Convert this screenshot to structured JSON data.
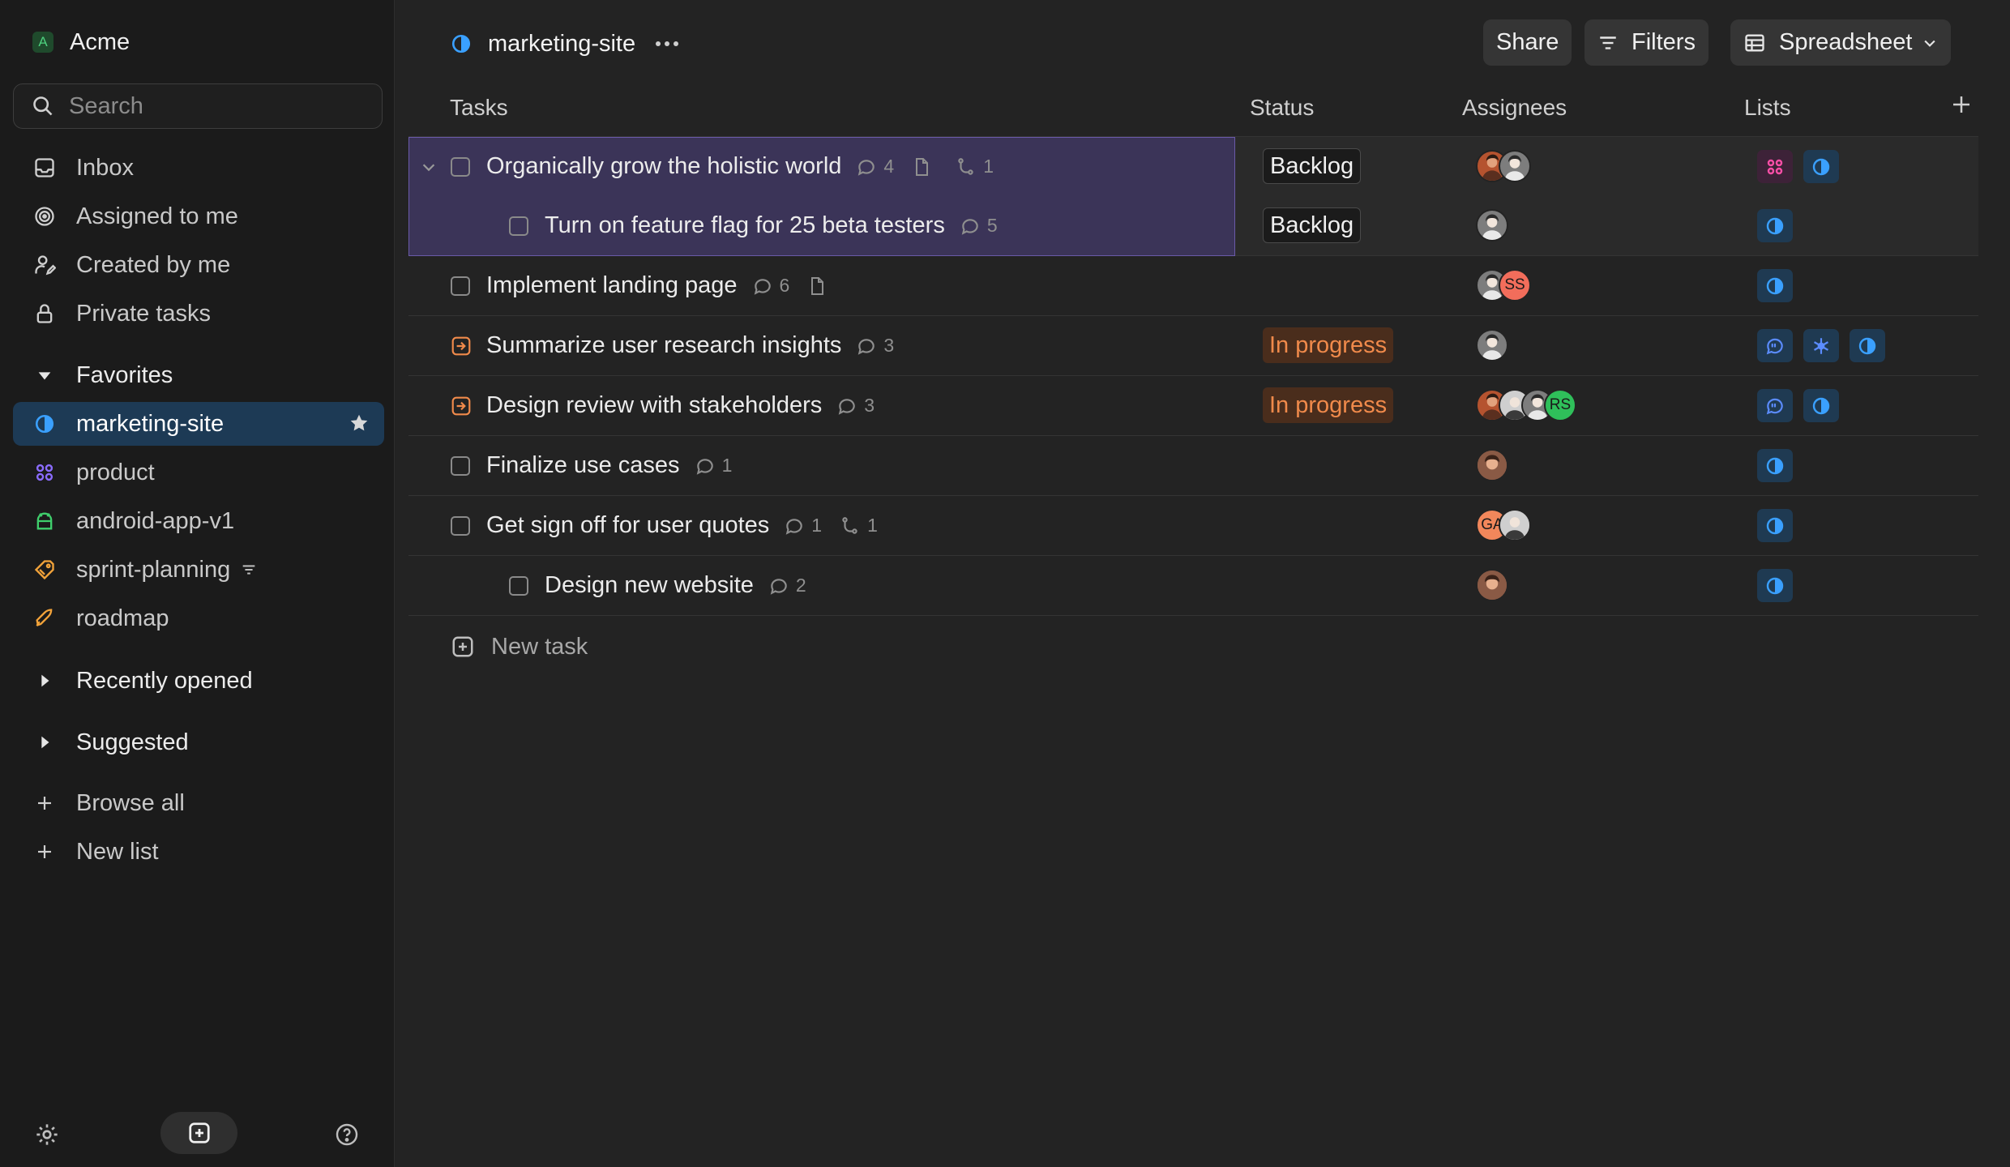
{
  "workspace": {
    "initial": "A",
    "name": "Acme"
  },
  "search": {
    "placeholder": "Search"
  },
  "nav": [
    {
      "label": "Inbox",
      "icon": "inbox-icon"
    },
    {
      "label": "Assigned to me",
      "icon": "target-icon"
    },
    {
      "label": "Created by me",
      "icon": "user-pen-icon"
    },
    {
      "label": "Private tasks",
      "icon": "lock-icon"
    }
  ],
  "favorites": {
    "heading": "Favorites",
    "items": [
      {
        "label": "marketing-site",
        "icon": "half-circle-icon",
        "color": "#3aa0ff",
        "active": true
      },
      {
        "label": "product",
        "icon": "grid-icon",
        "color": "#8b6cff"
      },
      {
        "label": "android-app-v1",
        "icon": "android-icon",
        "color": "#3fcf6c"
      },
      {
        "label": "sprint-planning",
        "icon": "tag-icon",
        "color": "#f2a33a"
      },
      {
        "label": "roadmap",
        "icon": "rocket-icon",
        "color": "#f2a33a"
      }
    ]
  },
  "recently_opened": {
    "heading": "Recently opened"
  },
  "suggested": {
    "heading": "Suggested"
  },
  "actions": {
    "browse_all": "Browse all",
    "new_list": "New list"
  },
  "header": {
    "project": "marketing-site",
    "share": "Share",
    "filters": "Filters",
    "view": "Spreadsheet"
  },
  "columns": {
    "tasks": "Tasks",
    "status": "Status",
    "assignees": "Assignees",
    "lists": "Lists"
  },
  "tasks": [
    {
      "title": "Organically grow the holistic world",
      "comments": "4",
      "has_doc": true,
      "subtasks": "1",
      "status": "Backlog",
      "assignees": [
        {
          "type": "photo",
          "color": "#b5532f"
        },
        {
          "type": "photo",
          "color": "#7d7d7d"
        }
      ],
      "lists": [
        "grid-pink",
        "half-blue"
      ]
    },
    {
      "title": "Turn on feature flag for 25 beta testers",
      "comments": "5",
      "status": "Backlog",
      "assignees": [
        {
          "type": "photo",
          "color": "#7d7d7d"
        }
      ],
      "lists": [
        "half-blue"
      ]
    },
    {
      "title": "Implement landing page",
      "comments": "6",
      "has_doc": true,
      "status": "",
      "assignees": [
        {
          "type": "photo",
          "color": "#7d7d7d"
        },
        {
          "type": "initials",
          "text": "SS",
          "color": "#f26d5b"
        }
      ],
      "lists": [
        "half-blue"
      ]
    },
    {
      "title": "Summarize user research insights",
      "comments": "3",
      "status": "In progress",
      "assignees": [
        {
          "type": "photo",
          "color": "#7d7d7d"
        }
      ],
      "lists": [
        "chat-blue",
        "snow-blue",
        "half-blue"
      ]
    },
    {
      "title": "Design review with stakeholders",
      "comments": "3",
      "status": "In progress",
      "assignees": [
        {
          "type": "photo",
          "color": "#b5532f"
        },
        {
          "type": "photo",
          "color": "#9a9a9a"
        },
        {
          "type": "photo",
          "color": "#7d7d7d"
        },
        {
          "type": "initials",
          "text": "RS",
          "color": "#2fbf5a"
        }
      ],
      "lists": [
        "chat-blue",
        "half-blue"
      ]
    },
    {
      "title": "Finalize use cases",
      "comments": "1",
      "status": "",
      "assignees": [
        {
          "type": "photo",
          "color": "#a0624a"
        }
      ],
      "lists": [
        "half-blue"
      ]
    },
    {
      "title": "Get sign off for user quotes",
      "comments": "1",
      "subtasks": "1",
      "status": "",
      "assignees": [
        {
          "type": "initials",
          "text": "GA",
          "color": "#f2875b"
        },
        {
          "type": "photo",
          "color": "#9a9a9a"
        }
      ],
      "lists": [
        "half-blue"
      ]
    },
    {
      "title": "Design new website",
      "comments": "2",
      "status": "",
      "assignees": [
        {
          "type": "photo",
          "color": "#a0624a"
        }
      ],
      "lists": [
        "half-blue"
      ]
    }
  ],
  "new_task": "New task"
}
